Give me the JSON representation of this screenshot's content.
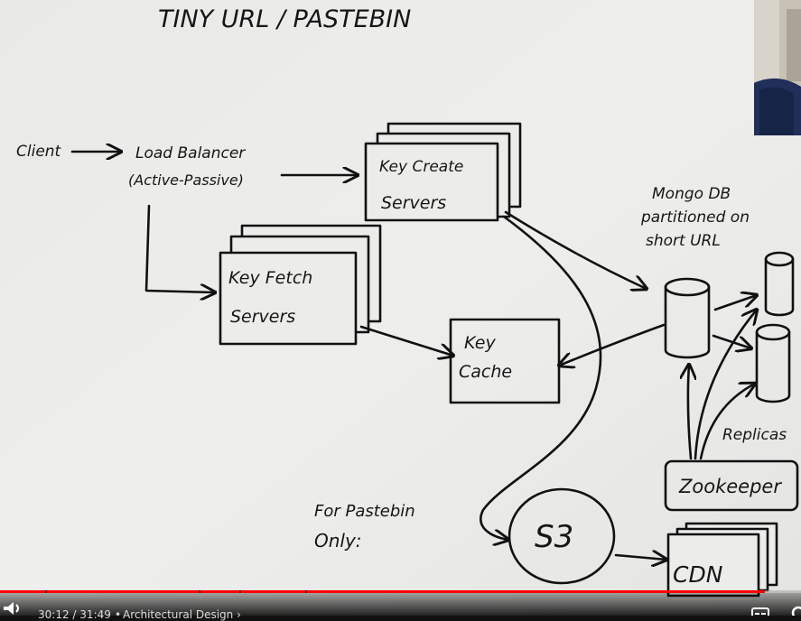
{
  "whiteboard": {
    "title": "TINY URL / PASTEBIN",
    "client": "Client",
    "load_balancer": [
      "Load Balancer",
      "(Active-Passive)"
    ],
    "key_create": [
      "Key Create",
      "Servers"
    ],
    "key_fetch": [
      "Key Fetch",
      "Servers"
    ],
    "key_cache": [
      "Key",
      "Cache"
    ],
    "mongodb": [
      "Mongo DB",
      "partitioned on",
      "short URL"
    ],
    "replicas": "Replicas",
    "zookeeper": "Zookeeper",
    "pastebin_note": [
      "For Pastebin",
      "Only:"
    ],
    "s3": "S3",
    "cdn": "CDN"
  },
  "player": {
    "progress": 0.955,
    "current_time": "30:12",
    "duration": "31:49",
    "time_separator": "/",
    "chapter_separator": "•",
    "chapter": "Architectural Design",
    "colors": {
      "progress": "#ff0000",
      "board": "#ededeb"
    },
    "icons": [
      "volume-icon",
      "chevron-right-icon",
      "closed-captions-icon",
      "settings-icon"
    ]
  }
}
